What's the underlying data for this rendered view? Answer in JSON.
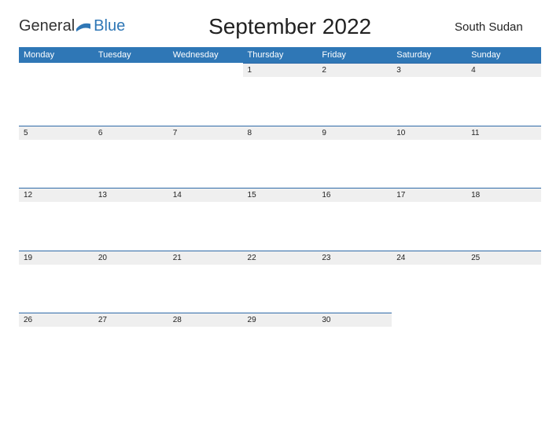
{
  "brand": {
    "word1": "General",
    "word2": "Blue"
  },
  "title": "September 2022",
  "region": "South Sudan",
  "days": [
    "Monday",
    "Tuesday",
    "Wednesday",
    "Thursday",
    "Friday",
    "Saturday",
    "Sunday"
  ],
  "weeks": [
    [
      "",
      "",
      "",
      "1",
      "2",
      "3",
      "4"
    ],
    [
      "5",
      "6",
      "7",
      "8",
      "9",
      "10",
      "11"
    ],
    [
      "12",
      "13",
      "14",
      "15",
      "16",
      "17",
      "18"
    ],
    [
      "19",
      "20",
      "21",
      "22",
      "23",
      "24",
      "25"
    ],
    [
      "26",
      "27",
      "28",
      "29",
      "30",
      "",
      ""
    ]
  ]
}
